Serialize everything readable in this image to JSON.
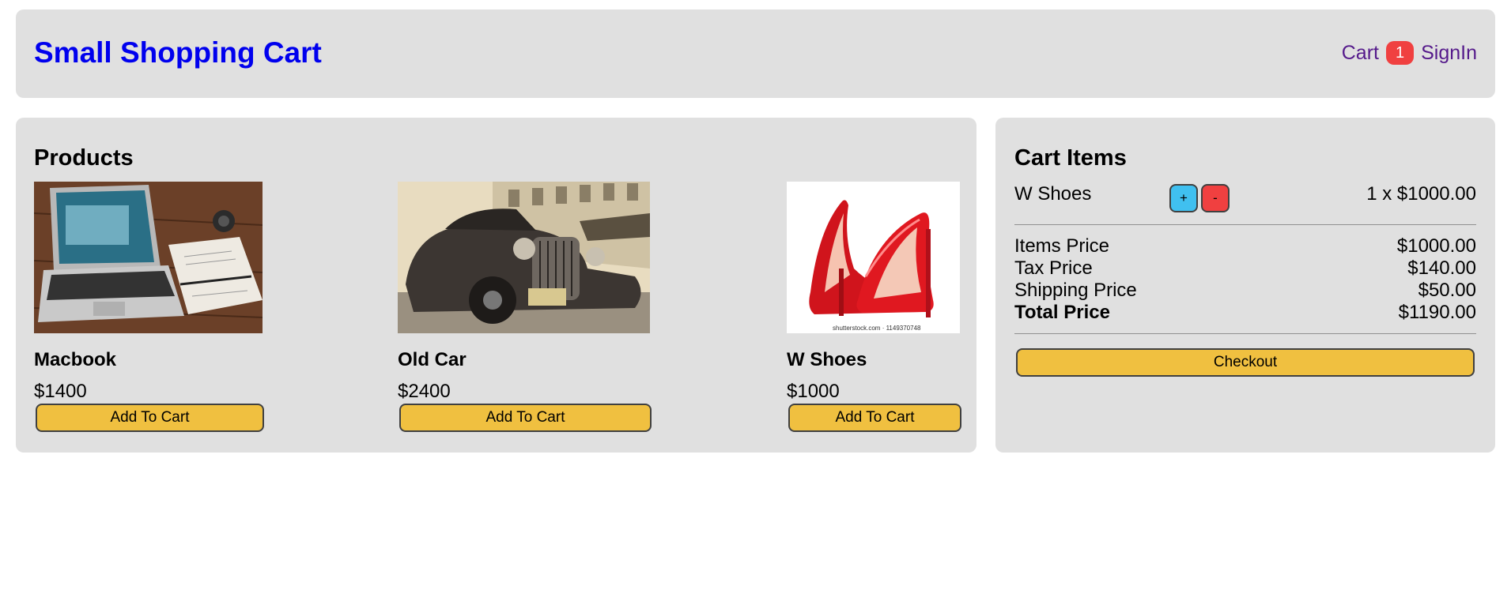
{
  "header": {
    "title": "Small Shopping Cart",
    "cart_label": "Cart",
    "cart_count": "1",
    "signin_label": "SignIn"
  },
  "products": {
    "heading": "Products",
    "items": [
      {
        "name": "Macbook",
        "price": "$1400",
        "button": "Add To Cart",
        "image": "laptop-photo"
      },
      {
        "name": "Old Car",
        "price": "$2400",
        "button": "Add To Cart",
        "image": "vintage-car-photo"
      },
      {
        "name": "W Shoes",
        "price": "$1000",
        "button": "Add To Cart",
        "image": "red-heels-photo",
        "image_caption": "shutterstock.com · 1149370748"
      }
    ]
  },
  "cart": {
    "heading": "Cart Items",
    "items": [
      {
        "name": "W Shoes",
        "plus": "+",
        "minus": "-",
        "qty_price": "1 x $1000.00"
      }
    ],
    "summary": {
      "items_label": "Items Price",
      "items_value": "$1000.00",
      "tax_label": "Tax Price",
      "tax_value": "$140.00",
      "shipping_label": "Shipping Price",
      "shipping_value": "$50.00",
      "total_label": "Total Price",
      "total_value": "$1190.00"
    },
    "checkout": "Checkout"
  },
  "colors": {
    "brand": "#0000ee",
    "panel": "#e0e0e0",
    "button": "#f0c040",
    "badge": "#f04040",
    "plus_button": "#40c0f0",
    "minus_button": "#f04040"
  }
}
